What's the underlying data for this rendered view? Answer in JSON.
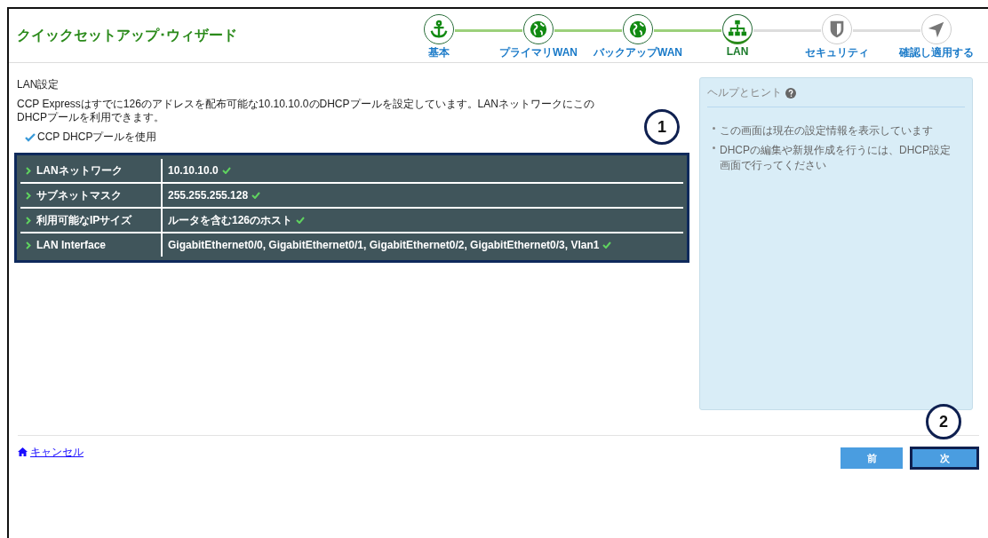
{
  "title": "クイックセットアップ･ウィザード",
  "steps": [
    {
      "label": "基本",
      "kind": "anchor",
      "completed": true,
      "selected": false
    },
    {
      "label": "プライマリWAN",
      "kind": "globe",
      "completed": true,
      "selected": false
    },
    {
      "label": "バックアップWAN",
      "kind": "globe",
      "completed": true,
      "selected": false
    },
    {
      "label": "LAN",
      "kind": "network",
      "completed": true,
      "selected": true
    },
    {
      "label": "セキュリティ",
      "kind": "shield",
      "completed": false,
      "selected": false
    },
    {
      "label": "確認し適用する",
      "kind": "send",
      "completed": false,
      "selected": false
    }
  ],
  "section": {
    "heading": "LAN設定",
    "description": "CCP Expressはすでに126のアドレスを配布可能な10.10.10.0のDHCPプールを設定しています。LANネットワークにこのDHCPプールを利用できます。",
    "option": {
      "label": "CCP DHCPプールを使用",
      "checked": true
    }
  },
  "table": {
    "highlighted": true,
    "rows": [
      {
        "label": "LANネットワーク",
        "value": "10.10.10.0"
      },
      {
        "label": "サブネットマスク",
        "value": "255.255.255.128"
      },
      {
        "label": "利用可能なIPサイズ",
        "value": "ルータを含む126のホスト"
      },
      {
        "label": "LAN Interface",
        "value": "GigabitEthernet0/0, GigabitEthernet0/1, GigabitEthernet0/2, GigabitEthernet0/3, Vlan1"
      }
    ]
  },
  "help": {
    "title": "ヘルプとヒント",
    "items": [
      "この画面は現在の設定情報を表示しています",
      "DHCPの編集や新規作成を行うには、DHCP設定画面で行ってください"
    ]
  },
  "cancel_link": "キャンセル",
  "buttons": [
    {
      "label": "前",
      "highlighted": false
    },
    {
      "label": "次",
      "highlighted": true
    }
  ],
  "callouts": [
    {
      "number": "1",
      "kind": "table"
    },
    {
      "number": "2",
      "kind": "button"
    }
  ]
}
